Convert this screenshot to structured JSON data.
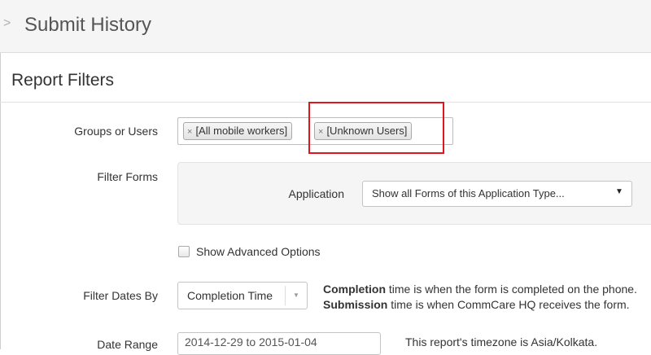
{
  "header": {
    "title": "Submit History",
    "chevron": ">"
  },
  "filters": {
    "section_title": "Report Filters",
    "groups_label": "Groups or Users",
    "tags": [
      {
        "label": "[All mobile workers]",
        "remove": "×"
      },
      {
        "label": "[Unknown Users]",
        "remove": "×"
      }
    ],
    "highlight_color": "#e0161f",
    "filter_forms_label": "Filter Forms",
    "application_label": "Application",
    "application_value": "Show all Forms of this Application Type...",
    "application_arrow": "▼",
    "advanced_label": "Show Advanced Options",
    "filter_dates_label": "Filter Dates By",
    "filter_dates_value": "Completion Time",
    "filter_dates_caret": "▼",
    "completion_bold": "Completion",
    "completion_rest": " time is when the form is completed on the phone.",
    "submission_bold": "Submission",
    "submission_rest": " time is when CommCare HQ receives the form.",
    "date_range_label": "Date Range",
    "date_range_value": "2014-12-29 to 2015-01-04",
    "timezone_note": "This report's timezone is Asia/Kolkata."
  }
}
